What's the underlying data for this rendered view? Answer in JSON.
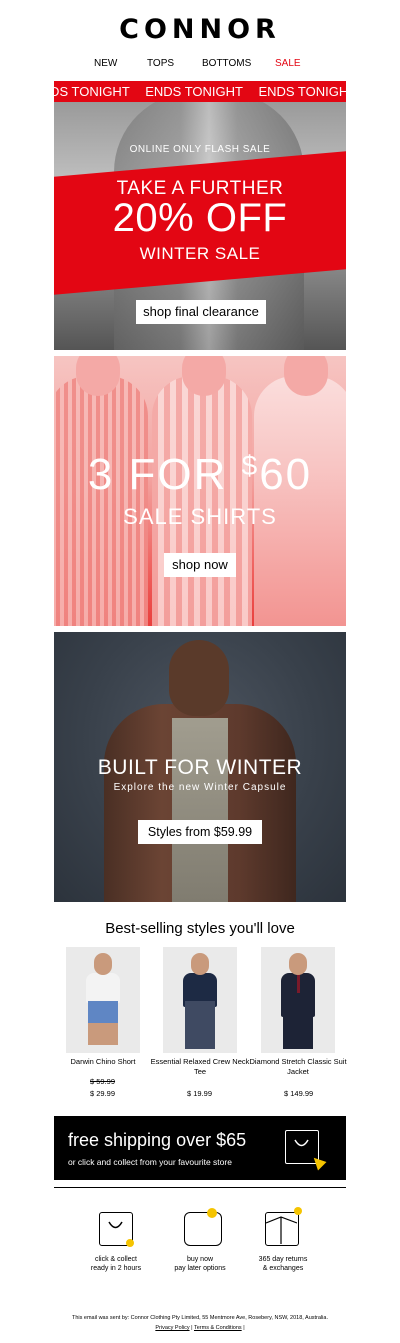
{
  "brand": "CONNOR",
  "nav": {
    "new": "NEW",
    "tops": "TOPS",
    "bottoms": "BOTTOMS",
    "sale": "SALE"
  },
  "ticker": "ENDS TONIGHT",
  "hero1": {
    "kicker": "ONLINE ONLY FLASH SALE",
    "line1": "TAKE A FURTHER",
    "line2": "20% OFF",
    "line3": "WINTER SALE",
    "cta": "shop final clearance"
  },
  "hero2": {
    "headline_pre": "3 FOR ",
    "headline_sup": "$",
    "headline_post": "60",
    "sub": "SALE SHIRTS",
    "cta": "shop now"
  },
  "hero3": {
    "title": "BUILT FOR WINTER",
    "subtitle": "Explore the new Winter Capsule",
    "cta": "Styles from $59.99"
  },
  "best": {
    "title": "Best-selling styles you'll love",
    "products": [
      {
        "name": "Darwin Chino Short",
        "was": "$ 59.99",
        "price": "$ 29.99"
      },
      {
        "name": "Essential Relaxed Crew Neck Tee",
        "was": "",
        "price": "$ 19.99"
      },
      {
        "name": "Diamond Stretch Classic Suit Jacket",
        "was": "",
        "price": "$ 149.99"
      }
    ]
  },
  "shipping": {
    "title": "free shipping over $65",
    "sub": "or click and collect from your favourite store"
  },
  "features": [
    {
      "line1": "click & collect",
      "line2": "ready in 2 hours"
    },
    {
      "line1": "buy now",
      "line2": "pay later options"
    },
    {
      "line1": "365 day returns",
      "line2": "& exchanges"
    }
  ],
  "footer": {
    "sent_by": "This email was sent by: Connor Clothing Pty Limited, 55 Mentmore Ave, Rosebery, NSW, 2018, Australia.",
    "privacy": "Privacy Policy",
    "terms": "Terms & Conditions",
    "separator": "|"
  },
  "colors": {
    "accent": "#e30613",
    "yellow": "#f5c400",
    "black": "#000000"
  }
}
